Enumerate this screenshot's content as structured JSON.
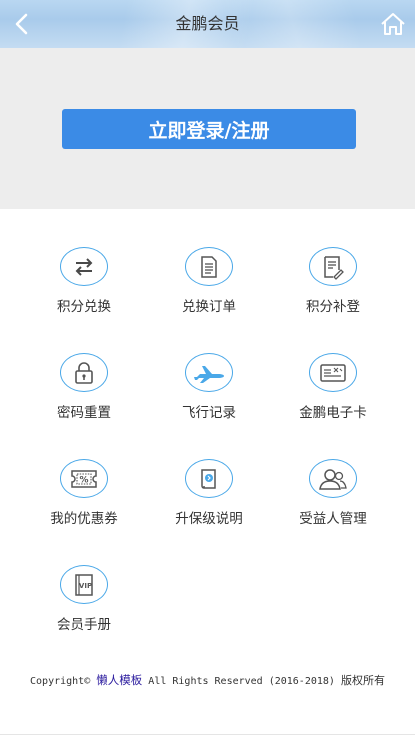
{
  "header": {
    "title": "金鹏会员",
    "back_icon": "chevron-left-icon",
    "home_icon": "home-icon"
  },
  "login": {
    "button_label": "立即登录/注册"
  },
  "menu": [
    {
      "label": "积分兑换",
      "icon": "exchange-icon"
    },
    {
      "label": "兑换订单",
      "icon": "order-document-icon"
    },
    {
      "label": "积分补登",
      "icon": "edit-document-icon"
    },
    {
      "label": "密码重置",
      "icon": "lock-icon"
    },
    {
      "label": "飞行记录",
      "icon": "airplane-icon"
    },
    {
      "label": "金鹏电子卡",
      "icon": "card-icon"
    },
    {
      "label": "我的优惠券",
      "icon": "coupon-icon"
    },
    {
      "label": "升保级说明",
      "icon": "book-icon"
    },
    {
      "label": "受益人管理",
      "icon": "users-icon"
    },
    {
      "label": "会员手册",
      "icon": "vip-icon"
    }
  ],
  "footer": {
    "prefix": "Copyright©",
    "brand": "懒人模板",
    "suffix": "All Rights Reserved (2016-2018)",
    "rights": "版权所有"
  },
  "colors": {
    "accent": "#3b8be6",
    "icon": "#4aa8e8",
    "login_bg": "#ededed"
  }
}
